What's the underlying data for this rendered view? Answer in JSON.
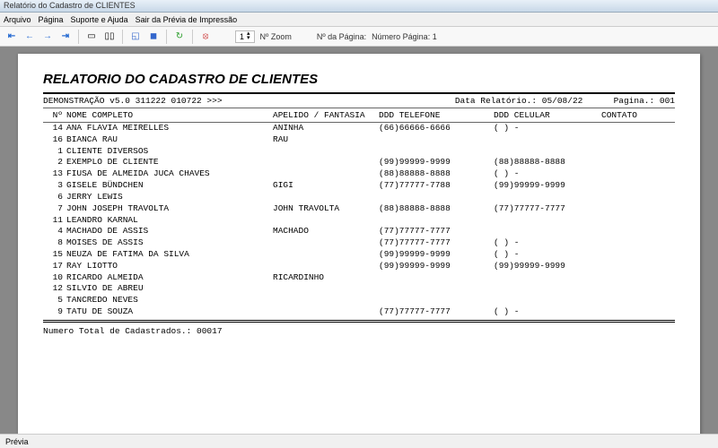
{
  "window": {
    "title": "Relatório do Cadastro de CLIENTES"
  },
  "menu": {
    "arquivo": "Arquivo",
    "pagina": "Página",
    "suporte": "Suporte e Ajuda",
    "sair": "Sair da Prévia de Impressão"
  },
  "toolbar": {
    "zoom_value": "1",
    "zoom_label": "Nº Zoom",
    "page_label": "Nº da Página:",
    "page_value": "Número Página: 1"
  },
  "report": {
    "title": "RELATORIO DO CADASTRO DE CLIENTES",
    "version": "DEMONSTRAÇÃO v5.0 311222 010722 >>>",
    "date_label": "Data Relatório.:",
    "date": "05/08/22",
    "page_label": "Pagina.:",
    "page": "001",
    "head": {
      "n": "Nº",
      "nome": "NOME COMPLETO",
      "apel": "APELIDO / FANTASIA",
      "tel": "DDD TELEFONE",
      "cel": "DDD CELULAR",
      "cont": "CONTATO"
    },
    "rows": [
      {
        "n": "14",
        "nome": "ANA FLAVIA MEIRELLES",
        "apel": "ANINHA",
        "tel": "(66)66666-6666",
        "cel": "(  )     -",
        "cont": ""
      },
      {
        "n": "16",
        "nome": "BIANCA RAU",
        "apel": "RAU",
        "tel": "",
        "cel": "",
        "cont": ""
      },
      {
        "n": "1",
        "nome": "CLIENTE DIVERSOS",
        "apel": "",
        "tel": "",
        "cel": "",
        "cont": ""
      },
      {
        "n": "2",
        "nome": "EXEMPLO DE CLIENTE",
        "apel": "",
        "tel": "(99)99999-9999",
        "cel": "(88)88888-8888",
        "cont": ""
      },
      {
        "n": "13",
        "nome": "FIUSA DE ALMEIDA JUCA CHAVES",
        "apel": "",
        "tel": "(88)88888-8888",
        "cel": "(  )     -",
        "cont": ""
      },
      {
        "n": "3",
        "nome": "GISELE BÜNDCHEN",
        "apel": "GIGI",
        "tel": "(77)77777-7788",
        "cel": "(99)99999-9999",
        "cont": ""
      },
      {
        "n": "6",
        "nome": "JERRY LEWIS",
        "apel": "",
        "tel": "",
        "cel": "",
        "cont": ""
      },
      {
        "n": "7",
        "nome": "JOHN JOSEPH TRAVOLTA",
        "apel": "JOHN TRAVOLTA",
        "tel": "(88)88888-8888",
        "cel": "(77)77777-7777",
        "cont": ""
      },
      {
        "n": "11",
        "nome": "LEANDRO KARNAL",
        "apel": "",
        "tel": "",
        "cel": "",
        "cont": ""
      },
      {
        "n": "4",
        "nome": "MACHADO DE ASSIS",
        "apel": "MACHADO",
        "tel": "(77)77777-7777",
        "cel": "",
        "cont": ""
      },
      {
        "n": "8",
        "nome": "MOISES DE ASSIS",
        "apel": "",
        "tel": "(77)77777-7777",
        "cel": "(  )     -",
        "cont": ""
      },
      {
        "n": "15",
        "nome": "NEUZA DE FATIMA DA SILVA",
        "apel": "",
        "tel": "(99)99999-9999",
        "cel": "(  )     -",
        "cont": ""
      },
      {
        "n": "17",
        "nome": "RAY LIOTTO",
        "apel": "",
        "tel": "(99)99999-9999",
        "cel": "(99)99999-9999",
        "cont": ""
      },
      {
        "n": "10",
        "nome": "RICARDO ALMEIDA",
        "apel": "RICARDINHO",
        "tel": "",
        "cel": "",
        "cont": ""
      },
      {
        "n": "12",
        "nome": "SILVIO DE ABREU",
        "apel": "",
        "tel": "",
        "cel": "",
        "cont": ""
      },
      {
        "n": "5",
        "nome": "TANCREDO NEVES",
        "apel": "",
        "tel": "",
        "cel": "",
        "cont": ""
      },
      {
        "n": "9",
        "nome": "TATU DE SOUZA",
        "apel": "",
        "tel": "(77)77777-7777",
        "cel": "(  )     -",
        "cont": ""
      }
    ],
    "total_label": "Numero Total de Cadastrados.:",
    "total": "00017"
  },
  "status": {
    "text": "Prévia"
  }
}
